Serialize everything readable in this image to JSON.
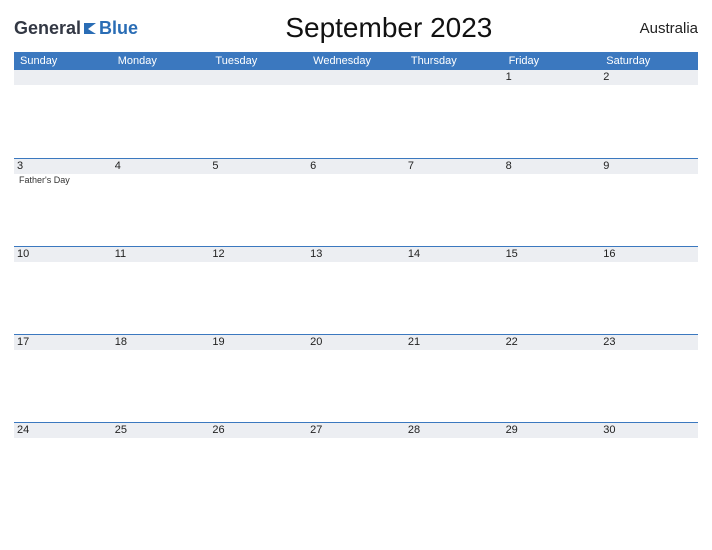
{
  "header": {
    "logo_part1": "General",
    "logo_part2": "Blue",
    "title": "September 2023",
    "region": "Australia"
  },
  "daynames": [
    "Sunday",
    "Monday",
    "Tuesday",
    "Wednesday",
    "Thursday",
    "Friday",
    "Saturday"
  ],
  "weeks": [
    [
      {
        "n": "",
        "e": ""
      },
      {
        "n": "",
        "e": ""
      },
      {
        "n": "",
        "e": ""
      },
      {
        "n": "",
        "e": ""
      },
      {
        "n": "",
        "e": ""
      },
      {
        "n": "1",
        "e": ""
      },
      {
        "n": "2",
        "e": ""
      }
    ],
    [
      {
        "n": "3",
        "e": "Father's Day"
      },
      {
        "n": "4",
        "e": ""
      },
      {
        "n": "5",
        "e": ""
      },
      {
        "n": "6",
        "e": ""
      },
      {
        "n": "7",
        "e": ""
      },
      {
        "n": "8",
        "e": ""
      },
      {
        "n": "9",
        "e": ""
      }
    ],
    [
      {
        "n": "10",
        "e": ""
      },
      {
        "n": "11",
        "e": ""
      },
      {
        "n": "12",
        "e": ""
      },
      {
        "n": "13",
        "e": ""
      },
      {
        "n": "14",
        "e": ""
      },
      {
        "n": "15",
        "e": ""
      },
      {
        "n": "16",
        "e": ""
      }
    ],
    [
      {
        "n": "17",
        "e": ""
      },
      {
        "n": "18",
        "e": ""
      },
      {
        "n": "19",
        "e": ""
      },
      {
        "n": "20",
        "e": ""
      },
      {
        "n": "21",
        "e": ""
      },
      {
        "n": "22",
        "e": ""
      },
      {
        "n": "23",
        "e": ""
      }
    ],
    [
      {
        "n": "24",
        "e": ""
      },
      {
        "n": "25",
        "e": ""
      },
      {
        "n": "26",
        "e": ""
      },
      {
        "n": "27",
        "e": ""
      },
      {
        "n": "28",
        "e": ""
      },
      {
        "n": "29",
        "e": ""
      },
      {
        "n": "30",
        "e": ""
      }
    ]
  ]
}
